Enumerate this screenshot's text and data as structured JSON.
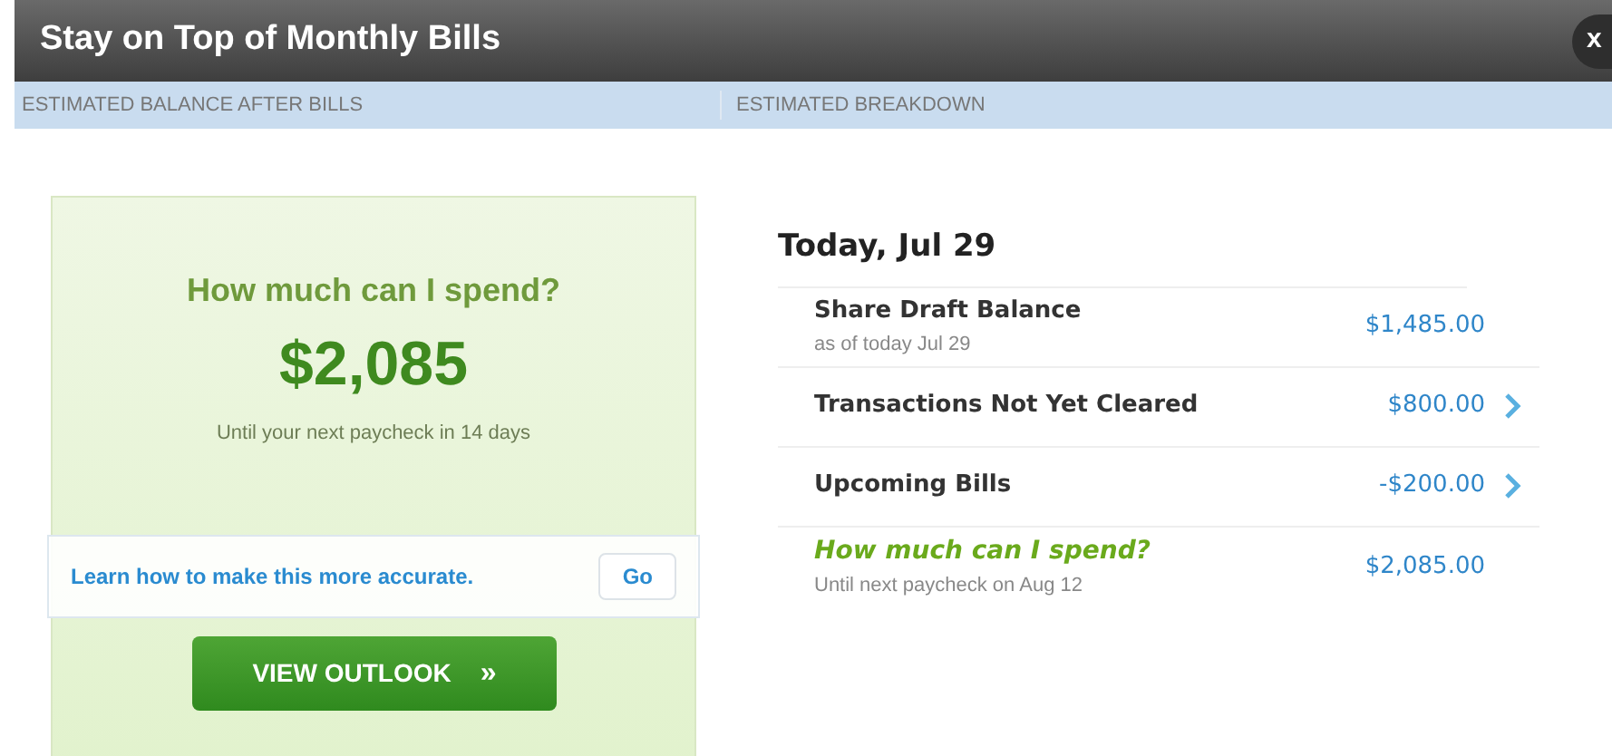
{
  "window": {
    "title": "Stay on Top of Monthly Bills",
    "close": "x"
  },
  "section_headers": [
    "ESTIMATED BALANCE AFTER BILLS",
    "ESTIMATED BREAKDOWN"
  ],
  "summary": {
    "question": "How much can I spend?",
    "amount": "$2,085",
    "note": "Until your next paycheck in 14 days",
    "tip": "Learn how to make this more accurate.",
    "tip_button": "Go",
    "button": "VIEW OUTLOOK",
    "button_icon": "»"
  },
  "breakdown": {
    "date": "Today, Jul 29",
    "rows": [
      {
        "kind": "detail",
        "label": "Share Draft Balance",
        "sub": "as of today Jul 29",
        "amount": "$1,485.00"
      },
      {
        "kind": "link",
        "label": "Transactions Not Yet Cleared",
        "amount": "$800.00"
      },
      {
        "kind": "link",
        "label": "Upcoming Bills",
        "amount": "-$200.00"
      },
      {
        "kind": "total",
        "label": "How much can I spend?",
        "sub": "Until next paycheck on Aug 12",
        "amount": "$2,085.00"
      }
    ]
  }
}
